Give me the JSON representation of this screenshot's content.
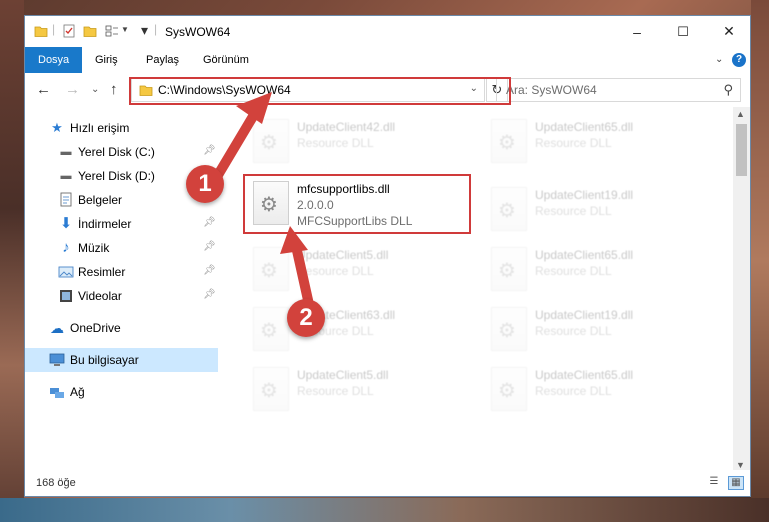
{
  "window": {
    "title": "SysWOW64",
    "minimize": "–",
    "maximize": "☐",
    "close": "✕"
  },
  "ribbon": {
    "tabs": [
      "Dosya",
      "Giriş",
      "Paylaş",
      "Görünüm"
    ],
    "help": "?"
  },
  "address": {
    "path": "C:\\Windows\\SysWOW64",
    "search_placeholder": "Ara: SysWOW64"
  },
  "sidebar": {
    "quick_access": "Hızlı erişim",
    "items": [
      {
        "label": "Yerel Disk (C:)",
        "pinned": true
      },
      {
        "label": "Yerel Disk (D:)",
        "pinned": false
      },
      {
        "label": "Belgeler",
        "pinned": true
      },
      {
        "label": "İndirmeler",
        "pinned": true
      },
      {
        "label": "Müzik",
        "pinned": true
      },
      {
        "label": "Resimler",
        "pinned": true
      },
      {
        "label": "Videolar",
        "pinned": true
      }
    ],
    "onedrive": "OneDrive",
    "this_pc": "Bu bilgisayar",
    "network": "Ağ"
  },
  "files": {
    "main": {
      "name": "mfcsupportlibs.dll",
      "version": "2.0.0.0",
      "description": "MFCSupportLibs DLL"
    },
    "left": [
      {
        "name": "UpdateClient42.dll",
        "type": "Resource DLL"
      },
      {
        "name": "UpdateClient5.dll",
        "type": "Resource DLL"
      },
      {
        "name": "UpdateClient63.dll",
        "type": "Resource DLL"
      },
      {
        "name": "UpdateClient5.dll",
        "type": "Resource DLL"
      }
    ],
    "right": [
      {
        "name": "UpdateClient65.dll",
        "type": "Resource DLL"
      },
      {
        "name": "UpdateClient19.dll",
        "type": "Resource DLL"
      },
      {
        "name": "UpdateClient65.dll",
        "type": "Resource DLL"
      },
      {
        "name": "UpdateClient19.dll",
        "type": "Resource DLL"
      },
      {
        "name": "UpdateClient65.dll",
        "type": "Resource DLL"
      }
    ]
  },
  "status": {
    "count": "168 öğe"
  },
  "callouts": [
    "1",
    "2"
  ],
  "colors": {
    "accent": "#1979ca",
    "highlight_red": "#d03a3a",
    "callout": "#d2423c",
    "selection": "#cce8ff"
  }
}
